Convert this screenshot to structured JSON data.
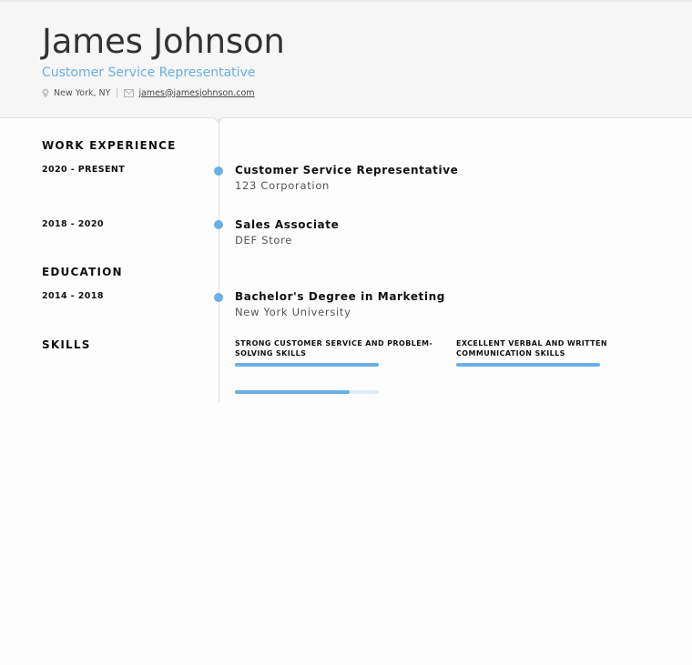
{
  "header": {
    "name": "James Johnson",
    "title": "Customer Service Representative",
    "location": "New York, NY",
    "email": "james@jamesjohnson.com"
  },
  "sections": {
    "work": "WORK EXPERIENCE",
    "education": "EDUCATION",
    "skills": "SKILLS"
  },
  "work": [
    {
      "dates": "2020 - PRESENT",
      "role": "Customer Service Representative",
      "org": "123 Corporation"
    },
    {
      "dates": "2018 - 2020",
      "role": "Sales Associate",
      "org": "DEF Store"
    }
  ],
  "education": [
    {
      "dates": "2014 - 2018",
      "degree": "Bachelor's Degree in Marketing",
      "school": "New York University"
    }
  ],
  "skills": [
    {
      "label": "STRONG CUSTOMER SERVICE AND PROBLEM-SOLVING SKILLS",
      "level": 1.0
    },
    {
      "label": "EXCELLENT VERBAL AND WRITTEN COMMUNICATION SKILLS",
      "level": 1.0
    },
    {
      "label": "",
      "level": 0.8
    }
  ],
  "colors": {
    "accent": "#6ab0e6",
    "header_bg": "#f6f6f6"
  }
}
